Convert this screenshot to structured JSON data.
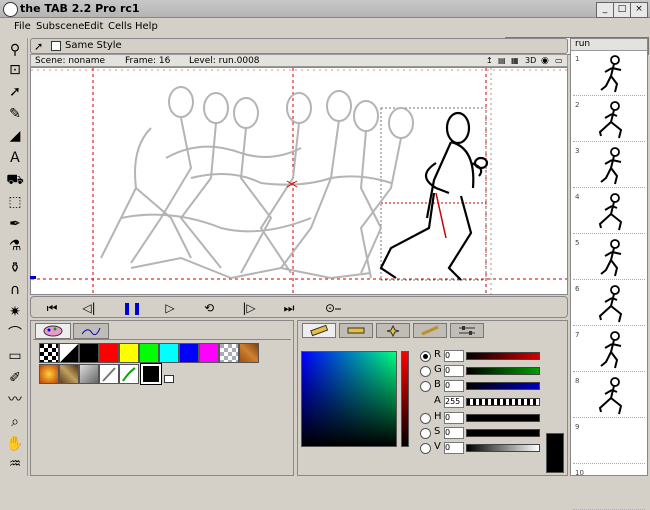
{
  "window": {
    "title": "the TAB 2.2 Pro rc1",
    "min": "_",
    "max": "□",
    "close": "×"
  },
  "menu": [
    "File",
    "Subscene",
    "Edit",
    "Cells",
    "Help"
  ],
  "toolbar": {
    "same_style_label": "Same Style",
    "same_style_checked": false
  },
  "info": {
    "scene": "Scene: noname",
    "frame": "Frame: 16",
    "level": "Level: run.0008",
    "mode3d": "3D"
  },
  "thumbnails": {
    "title": "run",
    "count": 8,
    "row_numbers": [
      "1",
      "2",
      "3",
      "4",
      "5",
      "6",
      "7",
      "8",
      "9",
      "10"
    ]
  },
  "color": {
    "channels": [
      {
        "id": "R",
        "value": "0",
        "selected": true,
        "color": "#d00000"
      },
      {
        "id": "G",
        "value": "0",
        "selected": false,
        "color": "#00a000"
      },
      {
        "id": "B",
        "value": "0",
        "selected": false,
        "color": "#0000c0"
      }
    ],
    "alpha": {
      "label": "A",
      "value": "255"
    },
    "hsv": [
      {
        "id": "H",
        "value": "0"
      },
      {
        "id": "S",
        "value": "0"
      },
      {
        "id": "V",
        "value": "0"
      }
    ],
    "current": "#000000"
  },
  "palette": {
    "swatches": [
      "checker",
      "checker-black",
      "#000000",
      "#ff0000",
      "#ffff00",
      "#00ff00",
      "#00ffff",
      "#0000ff",
      "#ff00ff",
      "checker-white",
      "texture-wood"
    ],
    "swatches_row2": [
      "texture-fire",
      "texture-rock",
      "texture-gray",
      "brush-1",
      "brush-2",
      "#000000"
    ]
  }
}
